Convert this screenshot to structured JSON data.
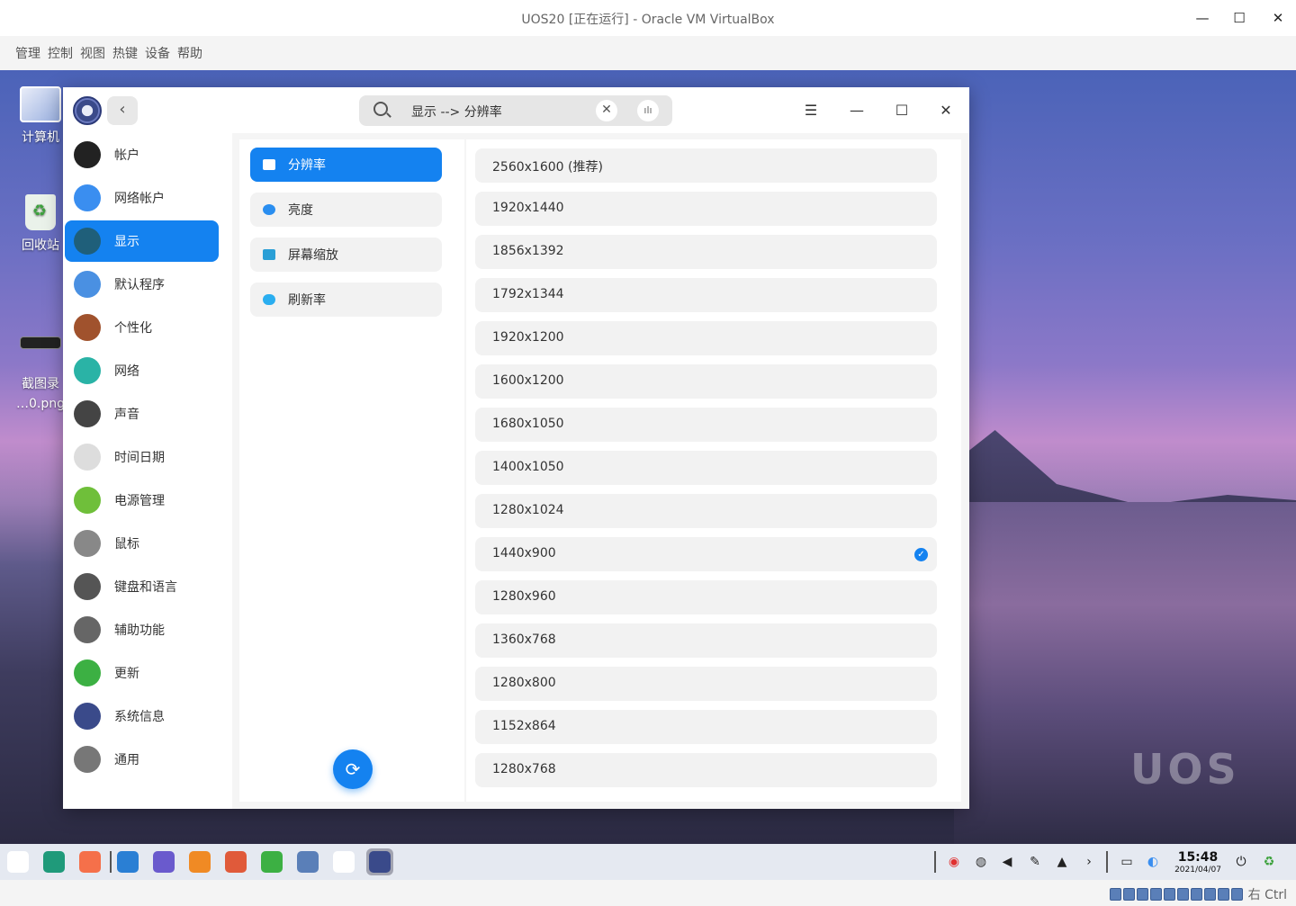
{
  "vbox": {
    "title": "UOS20 [正在运行] - Oracle VM VirtualBox",
    "menu": [
      "管理",
      "控制",
      "视图",
      "热键",
      "设备",
      "帮助"
    ],
    "host_key": "右 Ctrl"
  },
  "desktop": {
    "icons": [
      {
        "label": "计算机",
        "icon": "computer-icon"
      },
      {
        "label": "回收站",
        "icon": "trash-icon"
      },
      {
        "label": "截图录\n…0.png",
        "icon": "screenshot-file-icon"
      }
    ],
    "watermark": "UOS"
  },
  "window": {
    "search_text": "显示 --> 分辨率",
    "clear_glyph": "✕",
    "voice_glyph": "ılı",
    "back_glyph": "‹",
    "menu_glyph": "☰",
    "minimize_glyph": "—",
    "maximize_glyph": "☐",
    "close_glyph": "✕"
  },
  "sidebar": {
    "items": [
      {
        "label": "帐户",
        "icon": "account-icon",
        "color": "#222222"
      },
      {
        "label": "网络帐户",
        "icon": "cloud-icon",
        "color": "#3a8ef0"
      },
      {
        "label": "显示",
        "icon": "display-icon",
        "color": "#1f5f7a",
        "active": true
      },
      {
        "label": "默认程序",
        "icon": "default-apps-icon",
        "color": "#4a90e2"
      },
      {
        "label": "个性化",
        "icon": "palette-icon",
        "color": "#a0522d"
      },
      {
        "label": "网络",
        "icon": "network-icon",
        "color": "#2ab3a6"
      },
      {
        "label": "声音",
        "icon": "speaker-icon",
        "color": "#444444"
      },
      {
        "label": "时间日期",
        "icon": "clock-icon",
        "color": "#dddddd"
      },
      {
        "label": "电源管理",
        "icon": "battery-icon",
        "color": "#6fbf3a"
      },
      {
        "label": "鼠标",
        "icon": "mouse-icon",
        "color": "#888888"
      },
      {
        "label": "键盘和语言",
        "icon": "keyboard-icon",
        "color": "#555555"
      },
      {
        "label": "辅助功能",
        "icon": "microphone-icon",
        "color": "#666666"
      },
      {
        "label": "更新",
        "icon": "update-icon",
        "color": "#3cb043"
      },
      {
        "label": "系统信息",
        "icon": "system-info-icon",
        "color": "#3a4a8a"
      },
      {
        "label": "通用",
        "icon": "general-gear-icon",
        "color": "#777777"
      }
    ]
  },
  "display_menu": {
    "items": [
      {
        "label": "分辨率",
        "icon": "resolution-icon",
        "active": true
      },
      {
        "label": "亮度",
        "icon": "brightness-icon"
      },
      {
        "label": "屏幕缩放",
        "icon": "screen-scale-icon"
      },
      {
        "label": "刷新率",
        "icon": "refresh-rate-icon"
      }
    ],
    "rotate_glyph": "⟳"
  },
  "resolutions": {
    "items": [
      {
        "label": "2560x1600 (推荐)"
      },
      {
        "label": "1920x1440"
      },
      {
        "label": "1856x1392"
      },
      {
        "label": "1792x1344"
      },
      {
        "label": "1920x1200"
      },
      {
        "label": "1600x1200"
      },
      {
        "label": "1680x1050"
      },
      {
        "label": "1400x1050"
      },
      {
        "label": "1280x1024"
      },
      {
        "label": "1440x900",
        "selected": true
      },
      {
        "label": "1280x960"
      },
      {
        "label": "1360x768"
      },
      {
        "label": "1280x800"
      },
      {
        "label": "1152x864"
      },
      {
        "label": "1280x768"
      }
    ],
    "check_glyph": "✓"
  },
  "dock": {
    "apps": [
      {
        "icon": "launcher-icon",
        "color": "#ffffff"
      },
      {
        "icon": "multitask-view-icon",
        "color": "#1f9a7a"
      },
      {
        "icon": "app-store-icon",
        "color": "#f5704a"
      },
      {
        "icon": "file-manager-icon",
        "color": "#2a7fd4"
      },
      {
        "icon": "browser-icon",
        "color": "#6a5acd"
      },
      {
        "icon": "package-icon",
        "color": "#f08a24"
      },
      {
        "icon": "image-viewer-icon",
        "color": "#e05a3a"
      },
      {
        "icon": "music-icon",
        "color": "#3cb043"
      },
      {
        "icon": "document-viewer-icon",
        "color": "#5a7fb8"
      },
      {
        "icon": "calendar-icon",
        "color": "#ffffff"
      },
      {
        "icon": "control-center-icon",
        "color": "#3a4a8a",
        "active": true
      }
    ],
    "tray": [
      {
        "icon": "shield-icon",
        "glyph": "◉",
        "color": "#e03030"
      },
      {
        "icon": "globe-icon",
        "glyph": "◍",
        "color": "#333333"
      },
      {
        "icon": "volume-icon",
        "glyph": "◀",
        "color": "#222222"
      },
      {
        "icon": "pen-icon",
        "glyph": "✎",
        "color": "#222222"
      },
      {
        "icon": "bell-icon",
        "glyph": "▲",
        "color": "#222222"
      },
      {
        "icon": "expand-tray-icon",
        "glyph": "›",
        "color": "#222222"
      },
      {
        "icon": "keyboard-tray-icon",
        "glyph": "▭",
        "color": "#222222"
      },
      {
        "icon": "network-tray-icon",
        "glyph": "◐",
        "color": "#3a8ef0"
      },
      {
        "icon": "power-icon",
        "glyph": "⏻",
        "color": "#111111"
      },
      {
        "icon": "trash-tray-icon",
        "glyph": "♻",
        "color": "#3da23d"
      }
    ],
    "time": "15:48",
    "date": "2021/04/07"
  }
}
